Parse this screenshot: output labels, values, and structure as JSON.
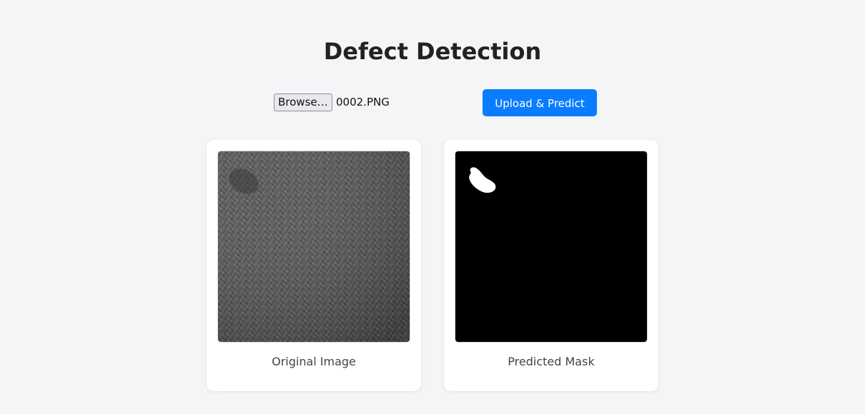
{
  "header": {
    "title": "Defect Detection"
  },
  "upload": {
    "browse_label": "Browse…",
    "selected_file": "0002.PNG",
    "submit_label": "Upload & Predict",
    "accent_color": "#0a7cff"
  },
  "results": [
    {
      "caption": "Original Image",
      "image": "grayscale-textured-fabric-image"
    },
    {
      "caption": "Predicted Mask",
      "image": "black-mask-with-white-defect-region"
    }
  ]
}
